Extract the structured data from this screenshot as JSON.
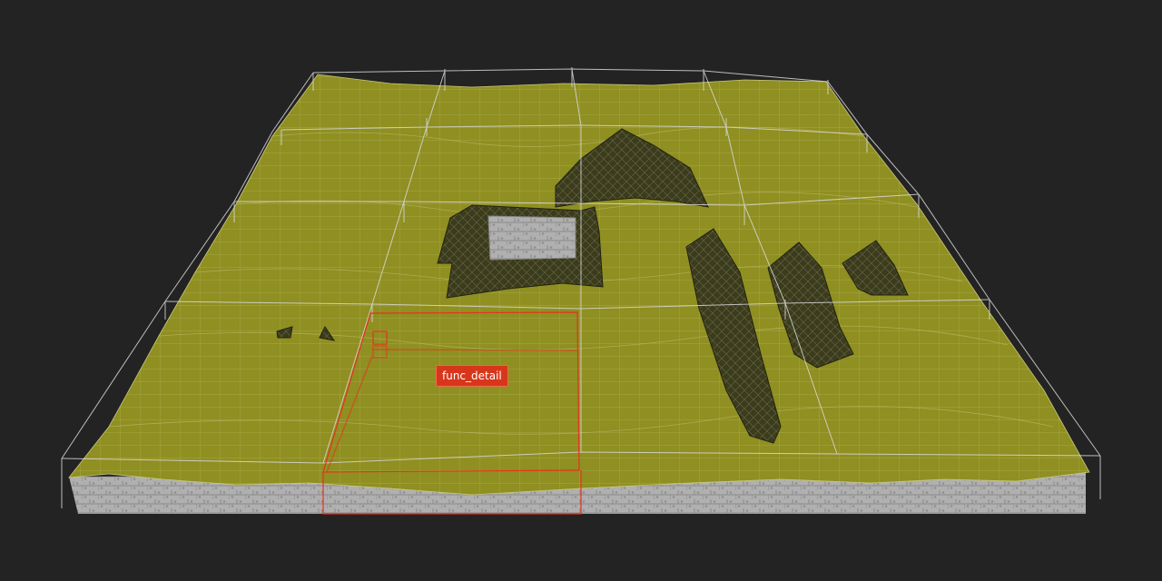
{
  "selection": {
    "entity_label": "func_detail"
  },
  "colors": {
    "background": "#232323",
    "terrain": "#8f8f22",
    "terrain_grid": "#c9c97a",
    "cliff_faces": "#3a3a1c",
    "brush_side": "#a9a9a9",
    "bounds_lines": "#d8d8d8",
    "selection": "#e8321c"
  }
}
